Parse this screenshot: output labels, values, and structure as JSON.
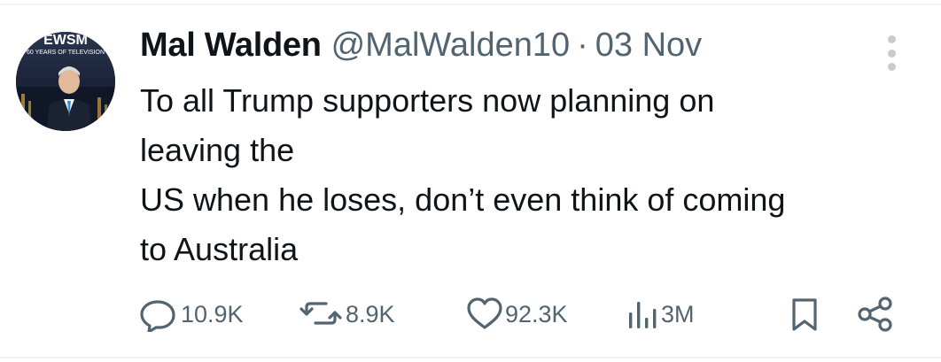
{
  "tweet": {
    "author_name": "Mal Walden",
    "handle": "@MalWalden10",
    "separator": "·",
    "date": "03 Nov",
    "text_lines": [
      "To all Trump supporters now planning on",
      "leaving the",
      "US when he loses, don’t even think of coming",
      "to Australia"
    ],
    "avatar": {
      "banner_text_top": "EWSM",
      "banner_text_sub": "60 YEARS OF TELEVISION"
    }
  },
  "actions": {
    "replies": "10.9K",
    "reposts": "8.9K",
    "likes": "92.3K",
    "views": "3M"
  },
  "icons": {
    "reply": "reply-icon",
    "repost": "repost-icon",
    "like": "heart-icon",
    "views": "views-icon",
    "bookmark": "bookmark-icon",
    "share": "share-icon",
    "more": "more-options-icon"
  },
  "colors": {
    "text": "#0f1419",
    "secondary": "#536471",
    "divider": "#eff3f4"
  }
}
